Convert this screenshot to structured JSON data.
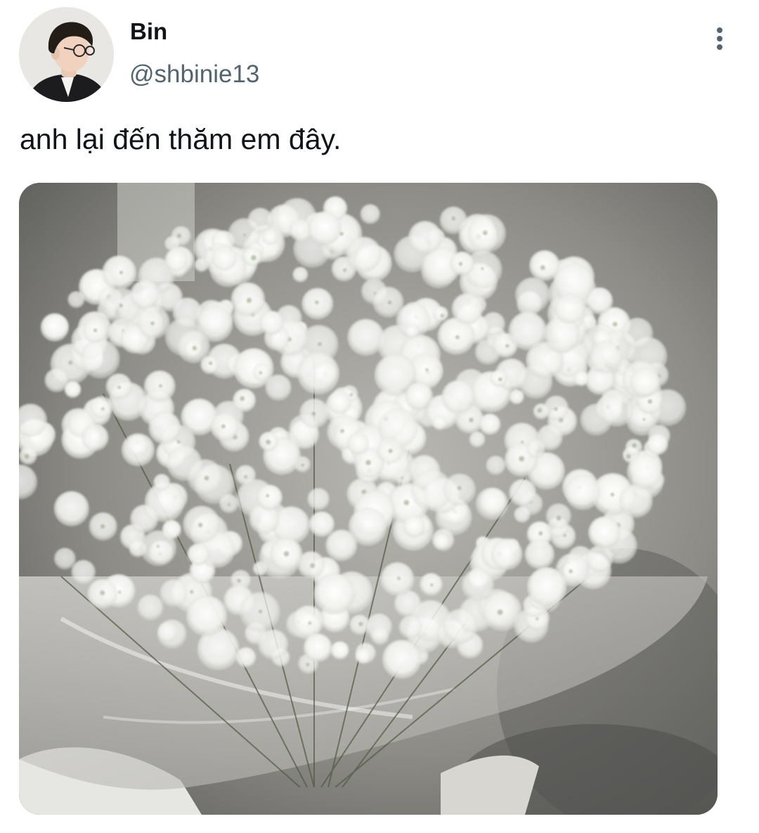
{
  "author": {
    "display_name": "Bin",
    "handle": "@shbinie13"
  },
  "tweet": {
    "text": "anh lại đến thăm em đây."
  },
  "icons": {
    "more": "more-vertical-icon",
    "avatar": "profile-photo",
    "media": "photo-white-babys-breath-bouquet"
  },
  "colors": {
    "background": "#ffffff",
    "text": "#0f1419",
    "secondary_text": "#536471"
  }
}
